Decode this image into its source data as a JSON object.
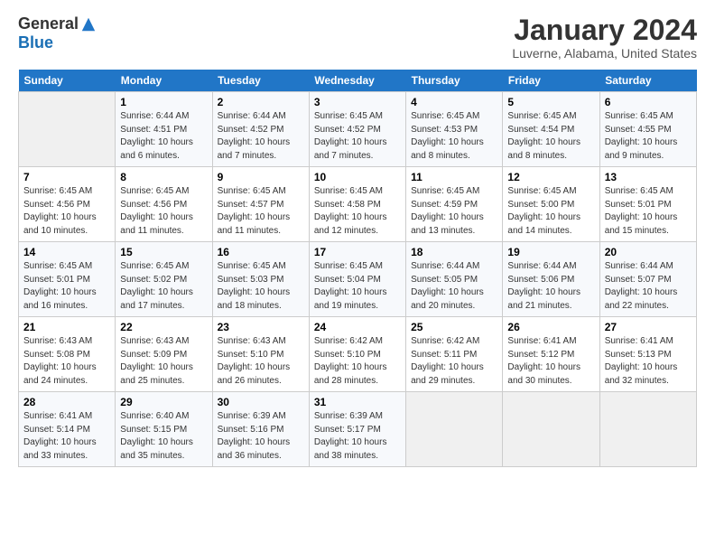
{
  "logo": {
    "general": "General",
    "blue": "Blue"
  },
  "header": {
    "month": "January 2024",
    "location": "Luverne, Alabama, United States"
  },
  "weekdays": [
    "Sunday",
    "Monday",
    "Tuesday",
    "Wednesday",
    "Thursday",
    "Friday",
    "Saturday"
  ],
  "weeks": [
    [
      {
        "day": "",
        "info": ""
      },
      {
        "day": "1",
        "info": "Sunrise: 6:44 AM\nSunset: 4:51 PM\nDaylight: 10 hours\nand 6 minutes."
      },
      {
        "day": "2",
        "info": "Sunrise: 6:44 AM\nSunset: 4:52 PM\nDaylight: 10 hours\nand 7 minutes."
      },
      {
        "day": "3",
        "info": "Sunrise: 6:45 AM\nSunset: 4:52 PM\nDaylight: 10 hours\nand 7 minutes."
      },
      {
        "day": "4",
        "info": "Sunrise: 6:45 AM\nSunset: 4:53 PM\nDaylight: 10 hours\nand 8 minutes."
      },
      {
        "day": "5",
        "info": "Sunrise: 6:45 AM\nSunset: 4:54 PM\nDaylight: 10 hours\nand 8 minutes."
      },
      {
        "day": "6",
        "info": "Sunrise: 6:45 AM\nSunset: 4:55 PM\nDaylight: 10 hours\nand 9 minutes."
      }
    ],
    [
      {
        "day": "7",
        "info": "Sunrise: 6:45 AM\nSunset: 4:56 PM\nDaylight: 10 hours\nand 10 minutes."
      },
      {
        "day": "8",
        "info": "Sunrise: 6:45 AM\nSunset: 4:56 PM\nDaylight: 10 hours\nand 11 minutes."
      },
      {
        "day": "9",
        "info": "Sunrise: 6:45 AM\nSunset: 4:57 PM\nDaylight: 10 hours\nand 11 minutes."
      },
      {
        "day": "10",
        "info": "Sunrise: 6:45 AM\nSunset: 4:58 PM\nDaylight: 10 hours\nand 12 minutes."
      },
      {
        "day": "11",
        "info": "Sunrise: 6:45 AM\nSunset: 4:59 PM\nDaylight: 10 hours\nand 13 minutes."
      },
      {
        "day": "12",
        "info": "Sunrise: 6:45 AM\nSunset: 5:00 PM\nDaylight: 10 hours\nand 14 minutes."
      },
      {
        "day": "13",
        "info": "Sunrise: 6:45 AM\nSunset: 5:01 PM\nDaylight: 10 hours\nand 15 minutes."
      }
    ],
    [
      {
        "day": "14",
        "info": "Sunrise: 6:45 AM\nSunset: 5:01 PM\nDaylight: 10 hours\nand 16 minutes."
      },
      {
        "day": "15",
        "info": "Sunrise: 6:45 AM\nSunset: 5:02 PM\nDaylight: 10 hours\nand 17 minutes."
      },
      {
        "day": "16",
        "info": "Sunrise: 6:45 AM\nSunset: 5:03 PM\nDaylight: 10 hours\nand 18 minutes."
      },
      {
        "day": "17",
        "info": "Sunrise: 6:45 AM\nSunset: 5:04 PM\nDaylight: 10 hours\nand 19 minutes."
      },
      {
        "day": "18",
        "info": "Sunrise: 6:44 AM\nSunset: 5:05 PM\nDaylight: 10 hours\nand 20 minutes."
      },
      {
        "day": "19",
        "info": "Sunrise: 6:44 AM\nSunset: 5:06 PM\nDaylight: 10 hours\nand 21 minutes."
      },
      {
        "day": "20",
        "info": "Sunrise: 6:44 AM\nSunset: 5:07 PM\nDaylight: 10 hours\nand 22 minutes."
      }
    ],
    [
      {
        "day": "21",
        "info": "Sunrise: 6:43 AM\nSunset: 5:08 PM\nDaylight: 10 hours\nand 24 minutes."
      },
      {
        "day": "22",
        "info": "Sunrise: 6:43 AM\nSunset: 5:09 PM\nDaylight: 10 hours\nand 25 minutes."
      },
      {
        "day": "23",
        "info": "Sunrise: 6:43 AM\nSunset: 5:10 PM\nDaylight: 10 hours\nand 26 minutes."
      },
      {
        "day": "24",
        "info": "Sunrise: 6:42 AM\nSunset: 5:10 PM\nDaylight: 10 hours\nand 28 minutes."
      },
      {
        "day": "25",
        "info": "Sunrise: 6:42 AM\nSunset: 5:11 PM\nDaylight: 10 hours\nand 29 minutes."
      },
      {
        "day": "26",
        "info": "Sunrise: 6:41 AM\nSunset: 5:12 PM\nDaylight: 10 hours\nand 30 minutes."
      },
      {
        "day": "27",
        "info": "Sunrise: 6:41 AM\nSunset: 5:13 PM\nDaylight: 10 hours\nand 32 minutes."
      }
    ],
    [
      {
        "day": "28",
        "info": "Sunrise: 6:41 AM\nSunset: 5:14 PM\nDaylight: 10 hours\nand 33 minutes."
      },
      {
        "day": "29",
        "info": "Sunrise: 6:40 AM\nSunset: 5:15 PM\nDaylight: 10 hours\nand 35 minutes."
      },
      {
        "day": "30",
        "info": "Sunrise: 6:39 AM\nSunset: 5:16 PM\nDaylight: 10 hours\nand 36 minutes."
      },
      {
        "day": "31",
        "info": "Sunrise: 6:39 AM\nSunset: 5:17 PM\nDaylight: 10 hours\nand 38 minutes."
      },
      {
        "day": "",
        "info": ""
      },
      {
        "day": "",
        "info": ""
      },
      {
        "day": "",
        "info": ""
      }
    ]
  ]
}
